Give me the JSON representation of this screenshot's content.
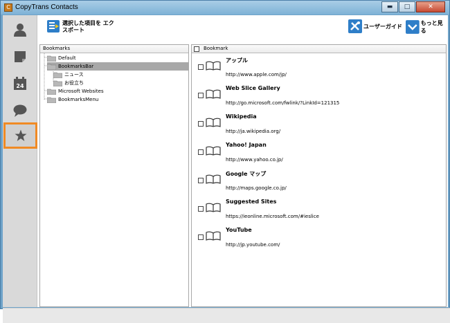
{
  "window": {
    "title": "CopyTrans Contacts",
    "icon_letter": "C",
    "buttons": {
      "minimize": "▬",
      "maximize": "□",
      "close": "✕"
    }
  },
  "sidebar": {
    "items": [
      {
        "name": "contacts",
        "icon": "person-icon"
      },
      {
        "name": "notes",
        "icon": "note-icon"
      },
      {
        "name": "calendar",
        "icon": "calendar-icon",
        "label": "24"
      },
      {
        "name": "messages",
        "icon": "chat-bubble-icon"
      },
      {
        "name": "bookmarks",
        "icon": "star-icon",
        "active": true
      }
    ],
    "active_color": "#f08a24"
  },
  "toolbar": {
    "export_label": "選択した項目を エクスポート",
    "guide_label": "ユーザーガイド",
    "more_label": "もっと見る"
  },
  "tree": {
    "header": "Bookmarks",
    "items": [
      {
        "label": "Default",
        "level": 1
      },
      {
        "label": "BookmarksBar",
        "level": 1,
        "selected": true
      },
      {
        "label": "ニュース",
        "level": 2
      },
      {
        "label": "お役立ち",
        "level": 2
      },
      {
        "label": "Microsoft Websites",
        "level": 1
      },
      {
        "label": "BookmarksMenu",
        "level": 1
      }
    ]
  },
  "list": {
    "header": "Bookmark",
    "items": [
      {
        "title": "アップル",
        "url": "http://www.apple.com/jp/"
      },
      {
        "title": "Web Slice Gallery",
        "url": "http://go.microsoft.com/fwlink/?LinkId=121315"
      },
      {
        "title": "Wikipedia",
        "url": "http://ja.wikipedia.org/"
      },
      {
        "title": "Yahoo! Japan",
        "url": "http://www.yahoo.co.jp/"
      },
      {
        "title": "Google マップ",
        "url": "http://maps.google.co.jp/"
      },
      {
        "title": "Suggested Sites",
        "url": "https://ieonline.microsoft.com/#ieslice"
      },
      {
        "title": "YouTube",
        "url": "http://jp.youtube.com/"
      }
    ]
  },
  "colors": {
    "accent": "#f08a24",
    "title_bar": "#7eb2d6",
    "selection": "#a8a8a8"
  }
}
